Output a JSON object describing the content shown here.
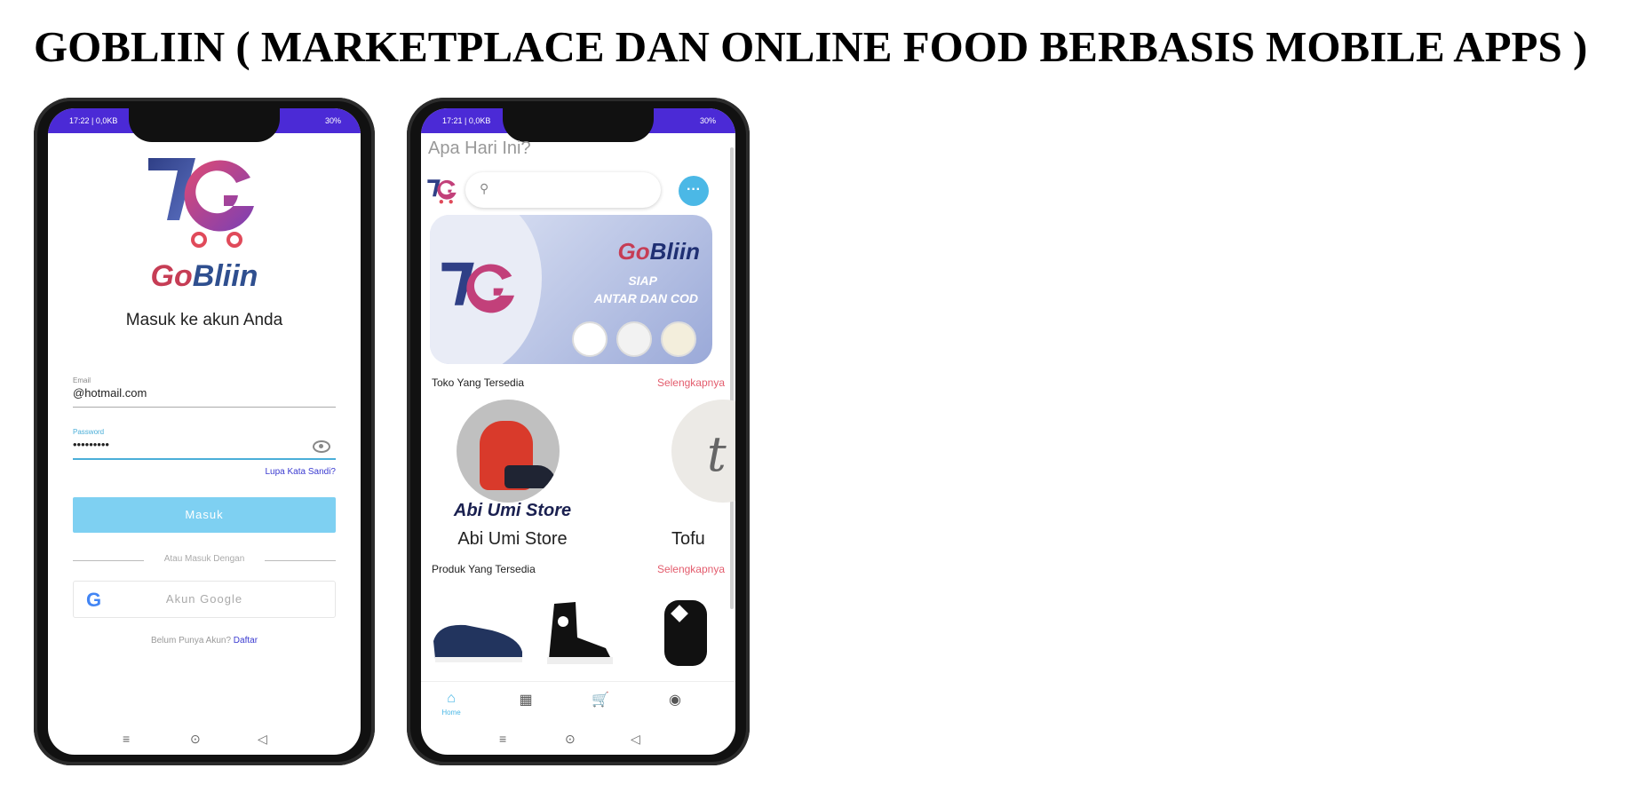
{
  "page_title": "GOBLIIN ( MARKETPLACE DAN ONLINE FOOD BERBASIS MOBILE APPS )",
  "colors": {
    "brand_red": "#c63d55",
    "brand_navy": "#1f2f73",
    "status_bar": "#4b2ad6",
    "accent_blue": "#4bb8e6",
    "link_red": "#e35c6d"
  },
  "login": {
    "status_time": "17:22 | 0,0KB",
    "status_battery": "30%",
    "brand_go": "Go",
    "brand_bliin": "Bliin",
    "subtitle": "Masuk ke akun Anda",
    "email_label": "Email",
    "email_value": "@hotmail.com",
    "password_label": "Password",
    "password_value": "•••••••••",
    "forgot": "Lupa Kata Sandi?",
    "login_button": "Masuk",
    "divider": "Atau Masuk Dengan",
    "google_button": "Akun Google",
    "signup_text": "Belum Punya Akun?",
    "signup_link": "Daftar"
  },
  "home": {
    "status_time": "17:21 | 0,0KB",
    "status_battery": "30%",
    "greeting": "Apa Hari Ini?",
    "banner": {
      "brand_go": "Go",
      "brand_bliin": "Bliin",
      "line1": "SIAP",
      "line2": "ANTAR DAN COD"
    },
    "stores_title": "Toko Yang Tersedia",
    "stores_more": "Selengkapnya",
    "stores": [
      {
        "overlay": "Abi Umi Store",
        "name": "Abi Umi Store"
      },
      {
        "overlay": "t",
        "name": "Tofu"
      }
    ],
    "products_title": "Produk Yang Tersedia",
    "products_more": "Selengkapnya",
    "nav": [
      {
        "label": "Home",
        "icon": "home-icon"
      },
      {
        "label": "",
        "icon": "dashboard-icon"
      },
      {
        "label": "",
        "icon": "cart-icon"
      },
      {
        "label": "",
        "icon": "account-icon"
      }
    ]
  }
}
